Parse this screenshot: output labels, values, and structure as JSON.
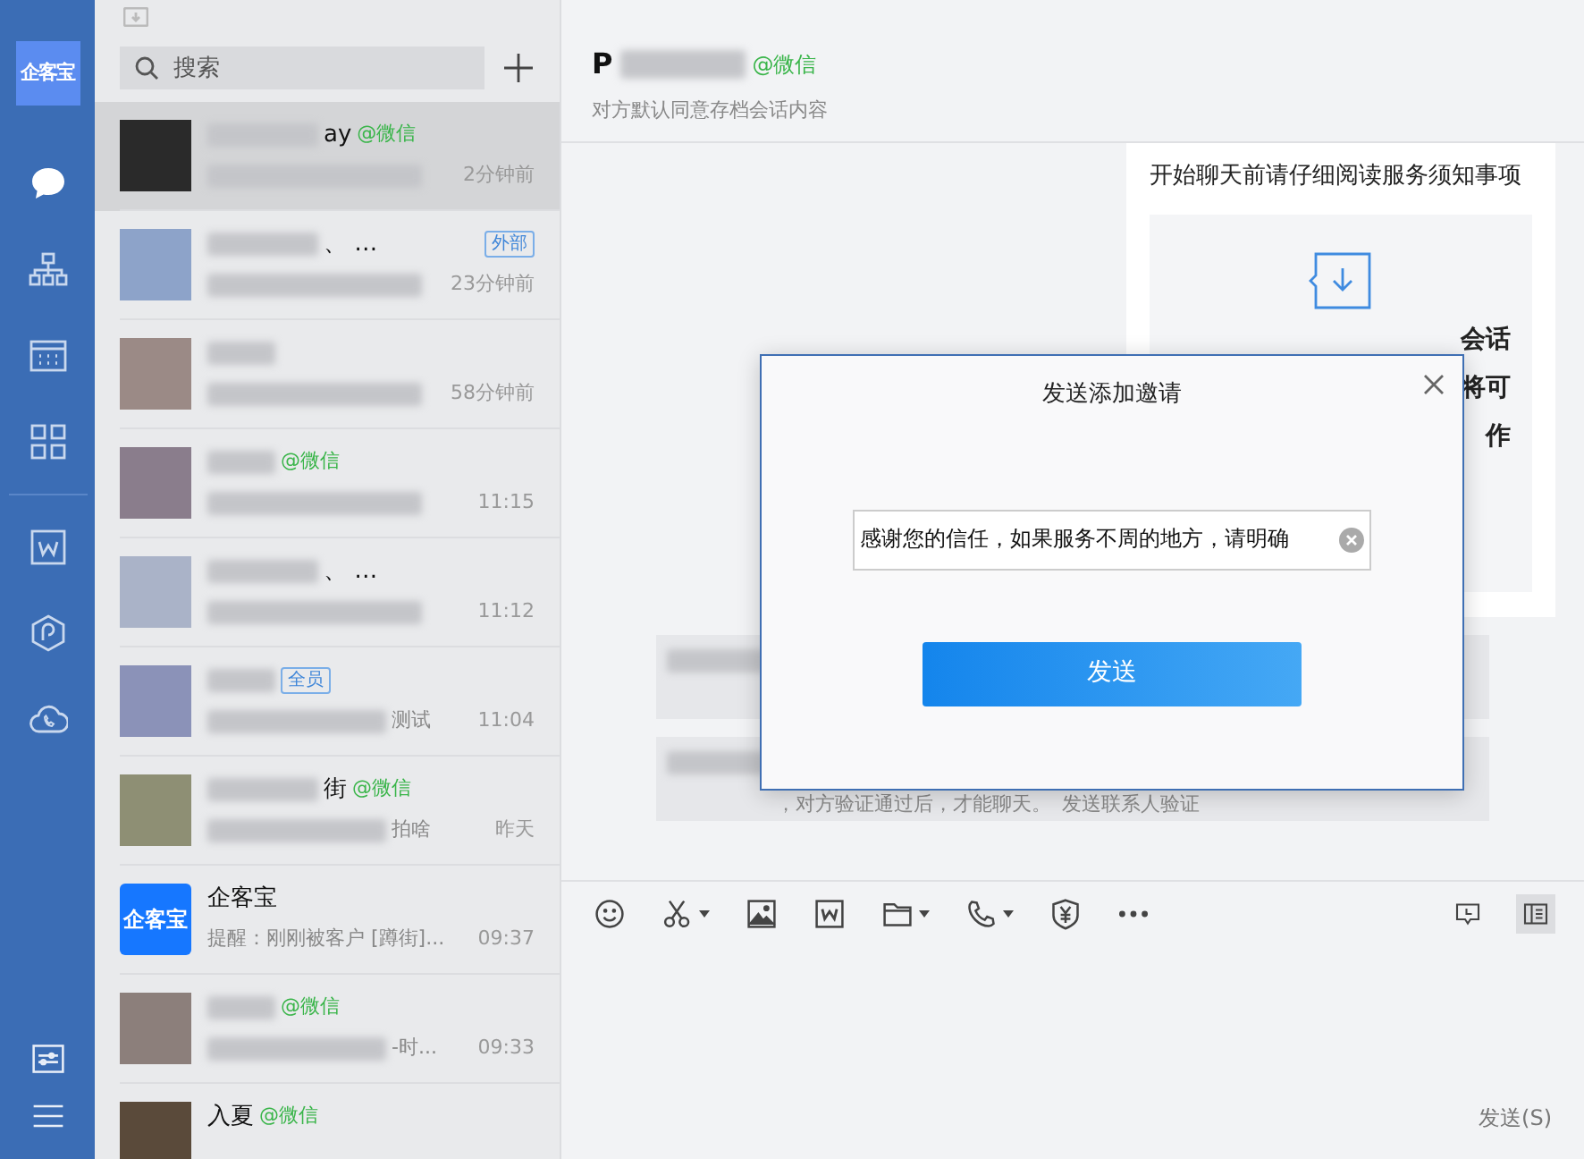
{
  "sidebar": {
    "logo": "企客宝",
    "items": [
      {
        "kind": "chat",
        "selected": true
      },
      {
        "kind": "org",
        "selected": false
      },
      {
        "kind": "calendar",
        "selected": false
      },
      {
        "kind": "apps",
        "selected": false
      },
      {
        "kind": "word",
        "selected": false
      },
      {
        "kind": "hexagon",
        "selected": false
      },
      {
        "kind": "cloud-phone",
        "selected": false
      }
    ],
    "bottom_items": [
      {
        "kind": "settings"
      },
      {
        "kind": "menu"
      }
    ]
  },
  "chat_list": {
    "search": {
      "placeholder": "搜索"
    },
    "conversations": [
      {
        "avatar": {
          "kind": "photo"
        },
        "name_blurred": true,
        "name": "ay",
        "tag": {
          "kind": "wechat",
          "text": "@微信"
        },
        "preview_blurred": true,
        "time": "2分钟前",
        "selected": true
      },
      {
        "avatar": {
          "kind": "photo"
        },
        "name_blurred": true,
        "name": "、 …",
        "tag": {
          "kind": "badge",
          "text": "外部"
        },
        "preview_blurred": true,
        "time": "23分钟前",
        "selected": false
      },
      {
        "avatar": {
          "kind": "photo"
        },
        "name_blurred": true,
        "preview_blurred": true,
        "time": "58分钟前",
        "selected": false
      },
      {
        "avatar": {
          "kind": "photo"
        },
        "name_blurred": true,
        "tag": {
          "kind": "wechat",
          "text": "@微信"
        },
        "preview_blurred": true,
        "time": "11:15",
        "selected": false
      },
      {
        "avatar": {
          "kind": "photo"
        },
        "name_blurred": true,
        "name": "、 …",
        "preview_blurred": true,
        "time": "11:12",
        "selected": false
      },
      {
        "avatar": {
          "kind": "photo"
        },
        "name_blurred": true,
        "tag": {
          "kind": "badge",
          "text": "全员"
        },
        "preview_blurred": true,
        "preview": "测试",
        "time": "11:04",
        "selected": false
      },
      {
        "avatar": {
          "kind": "photo"
        },
        "name_blurred": true,
        "name": "街",
        "tag": {
          "kind": "wechat",
          "text": "@微信"
        },
        "preview_blurred": true,
        "preview": "拍啥",
        "time": "昨天",
        "selected": false
      },
      {
        "avatar": {
          "kind": "logo",
          "text": "企客宝"
        },
        "name_blurred": false,
        "name": "企客宝",
        "preview_blurred": false,
        "preview": "提醒：刚刚被客户 [蹲街]...",
        "time": "09:37",
        "selected": false
      },
      {
        "avatar": {
          "kind": "photo"
        },
        "name_blurred": true,
        "tag": {
          "kind": "wechat",
          "text": "@微信"
        },
        "preview_blurred": true,
        "preview": "-时...",
        "time": "09:33",
        "selected": false
      },
      {
        "avatar": {
          "kind": "photo"
        },
        "name_blurred": false,
        "name": "入夏",
        "tag": {
          "kind": "wechat",
          "text": "@微信"
        },
        "preview_blurred": false,
        "selected": false
      }
    ]
  },
  "chat": {
    "header": {
      "name": "P",
      "name_blurred": true,
      "tag": "@微信",
      "subtitle": "对方默认同意存档会话内容"
    },
    "notice_card": {
      "title": "开始聊天前请仔细阅读服务须知事项",
      "fragments": [
        "会话",
        "将可",
        "作"
      ]
    },
    "system_messages": [
      {
        "text_blurred": true
      },
      {
        "text_blurred": true,
        "text": "，对方验证通过后，才能聊天。",
        "link": "发送联系人验证"
      }
    ],
    "toolbar": [
      {
        "kind": "emoji",
        "dropdown": false
      },
      {
        "kind": "scissors",
        "dropdown": true
      },
      {
        "kind": "image",
        "dropdown": false
      },
      {
        "kind": "word",
        "dropdown": false
      },
      {
        "kind": "folder",
        "dropdown": true
      },
      {
        "kind": "phone",
        "dropdown": true
      },
      {
        "kind": "yen-shield",
        "dropdown": false
      },
      {
        "kind": "more",
        "dropdown": false
      }
    ],
    "toolbar_right": [
      {
        "kind": "history",
        "selected": false
      },
      {
        "kind": "side-panel",
        "selected": true
      }
    ],
    "send_button": "发送(S)"
  },
  "dialog": {
    "title": "发送添加邀请",
    "input_value": "感谢您的信任，如果服务不周的地方，请明确",
    "button": "发送"
  }
}
